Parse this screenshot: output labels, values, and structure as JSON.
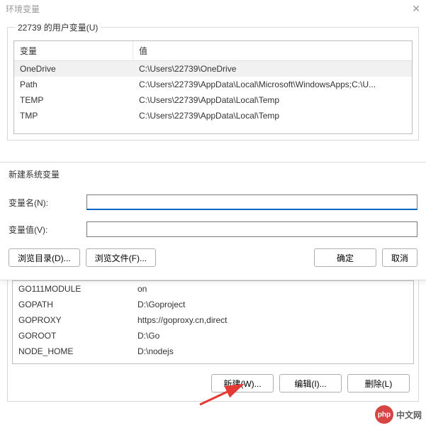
{
  "window": {
    "title": "环境变量"
  },
  "userVars": {
    "groupLabel": "22739 的用户变量(U)",
    "columns": {
      "name": "变量",
      "value": "值"
    },
    "rows": [
      {
        "name": "OneDrive",
        "value": "C:\\Users\\22739\\OneDrive"
      },
      {
        "name": "Path",
        "value": "C:\\Users\\22739\\AppData\\Local\\Microsoft\\WindowsApps;C:\\U..."
      },
      {
        "name": "TEMP",
        "value": "C:\\Users\\22739\\AppData\\Local\\Temp"
      },
      {
        "name": "TMP",
        "value": "C:\\Users\\22739\\AppData\\Local\\Temp"
      }
    ]
  },
  "newVarDialog": {
    "title": "新建系统变量",
    "nameLabel": "变量名(N):",
    "valueLabel": "变量值(V):",
    "nameValue": "",
    "valueValue": "",
    "browseDir": "浏览目录(D)...",
    "browseFile": "浏览文件(F)...",
    "ok": "确定",
    "cancel": "取消"
  },
  "sysVars": {
    "rows": [
      {
        "name": "GO111MODULE",
        "value": "on"
      },
      {
        "name": "GOPATH",
        "value": "D:\\Goproject"
      },
      {
        "name": "GOPROXY",
        "value": "https://goproxy.cn,direct"
      },
      {
        "name": "GOROOT",
        "value": "D:\\Go"
      },
      {
        "name": "NODE_HOME",
        "value": "D:\\nodejs"
      }
    ],
    "buttons": {
      "new": "新建(W)...",
      "edit": "编辑(I)...",
      "delete": "删除(L)"
    }
  },
  "watermark": {
    "badge": "php",
    "text": "中文网"
  }
}
